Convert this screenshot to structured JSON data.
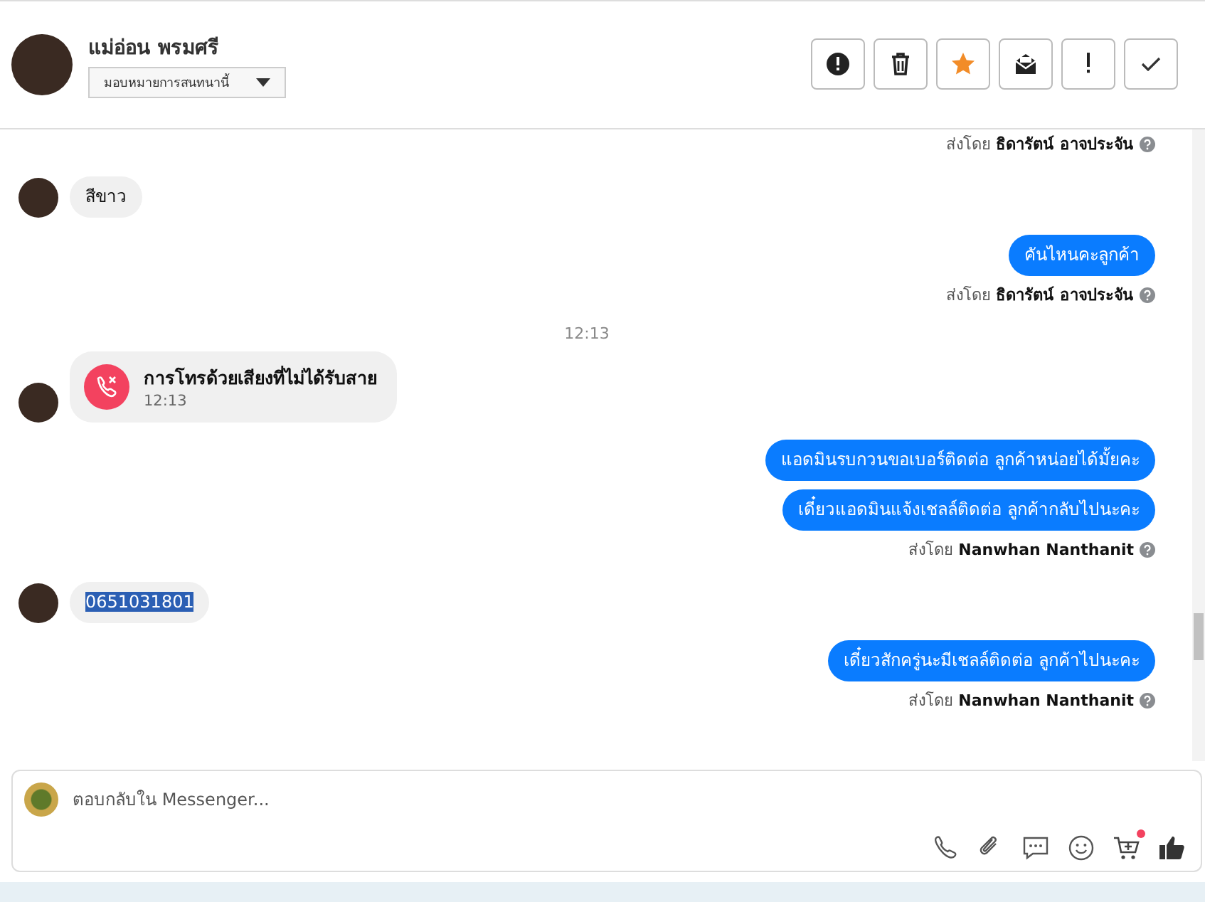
{
  "header": {
    "name": "แม่อ่อน พรมศรี",
    "assign_label": "มอบหมายการสนทนานี้",
    "actions": [
      {
        "kind": "alert"
      },
      {
        "kind": "trash"
      },
      {
        "kind": "star"
      },
      {
        "kind": "mail"
      },
      {
        "kind": "exclaim"
      },
      {
        "kind": "check"
      }
    ]
  },
  "messages": [
    {
      "kind": "note",
      "prefix": "ส่งโดย",
      "sender": "ธิดารัตน์ อาจประจัน"
    },
    {
      "kind": "incoming",
      "text": "สีขาว",
      "text_selected": false
    },
    {
      "kind": "outgoing",
      "text": "คันไหนคะลูกค้า"
    },
    {
      "kind": "note",
      "prefix": "ส่งโดย",
      "sender": "ธิดารัตน์ อาจประจัน"
    },
    {
      "kind": "time",
      "text": "12:13"
    },
    {
      "kind": "missed_call",
      "text": "การโทรด้วยเสียงที่ไม่ได้รับสาย",
      "time": "12:13"
    },
    {
      "kind": "outgoing",
      "text": "แอดมินรบกวนขอเบอร์ติดต่อ ลูกค้าหน่อยได้มั้ยคะ"
    },
    {
      "kind": "outgoing",
      "text": "เดี๋ยวแอดมินแจ้งเชลล์ติดต่อ ลูกค้ากลับไปนะคะ"
    },
    {
      "kind": "note",
      "prefix": "ส่งโดย",
      "sender": "Nanwhan Nanthanit"
    },
    {
      "kind": "incoming",
      "text": "0651031801",
      "text_selected": true
    },
    {
      "kind": "outgoing",
      "text": "เดี๋ยวสักครู่นะมีเชลล์ติดต่อ ลูกค้าไปนะคะ"
    },
    {
      "kind": "note",
      "prefix": "ส่งโดย",
      "sender": "Nanwhan Nanthanit"
    }
  ],
  "composer": {
    "placeholder": "ตอบกลับใน Messenger...",
    "tools": [
      {
        "kind": "phone"
      },
      {
        "kind": "clip"
      },
      {
        "kind": "chat"
      },
      {
        "kind": "smile"
      },
      {
        "kind": "cart",
        "badge": true
      },
      {
        "kind": "like"
      }
    ]
  }
}
